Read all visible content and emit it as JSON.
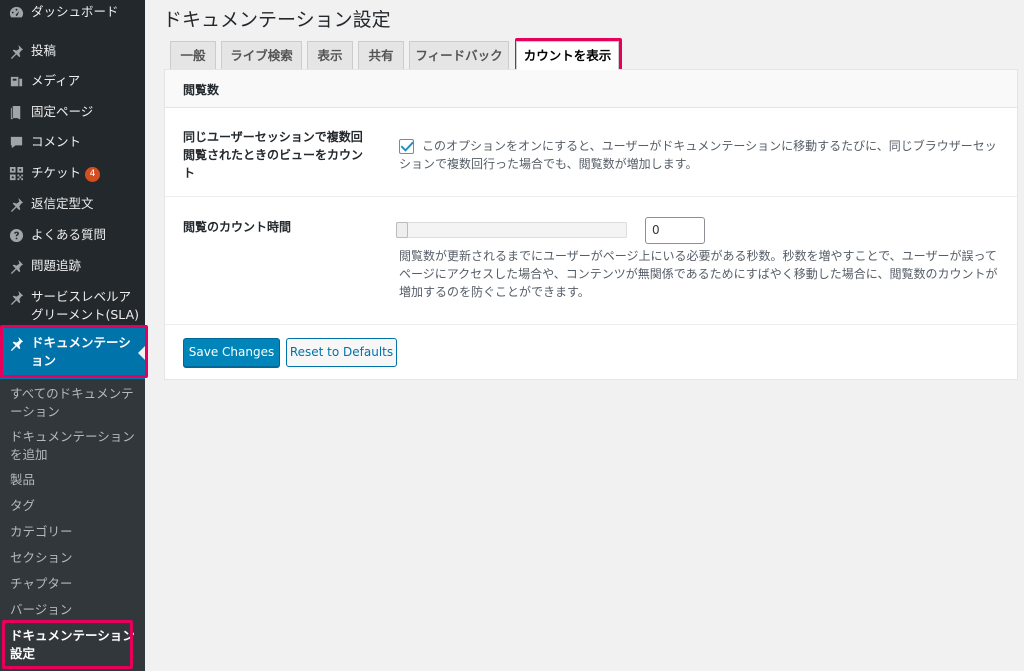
{
  "sidebar": {
    "items": [
      {
        "label": "ダッシュボード",
        "icon": "dashboard-icon"
      },
      {
        "label": "投稿",
        "icon": "pin-icon"
      },
      {
        "label": "メディア",
        "icon": "media-icon"
      },
      {
        "label": "固定ページ",
        "icon": "page-icon"
      },
      {
        "label": "コメント",
        "icon": "comment-icon"
      },
      {
        "label": "チケット",
        "icon": "ticket-icon",
        "badge": "4"
      },
      {
        "label": "返信定型文",
        "icon": "pin-icon"
      },
      {
        "label": "よくある質問",
        "icon": "question-icon"
      },
      {
        "label": "問題追跡",
        "icon": "pin-icon"
      },
      {
        "label": "サービスレベルアグリーメント(SLA)",
        "icon": "pin-icon"
      },
      {
        "label": "ドキュメンテーション",
        "icon": "pin-icon",
        "active": true
      }
    ],
    "submenu": [
      {
        "label": "すべてのドキュメンテーション"
      },
      {
        "label": "ドキュメンテーションを追加"
      },
      {
        "label": "製品"
      },
      {
        "label": "タグ"
      },
      {
        "label": "カテゴリー"
      },
      {
        "label": "セクション"
      },
      {
        "label": "チャプター"
      },
      {
        "label": "バージョン"
      },
      {
        "label": "ドキュメンテーション設定",
        "current": true
      }
    ]
  },
  "page": {
    "title": "ドキュメンテーション設定"
  },
  "tabs": [
    {
      "label": "一般"
    },
    {
      "label": "ライブ検索"
    },
    {
      "label": "表示"
    },
    {
      "label": "共有"
    },
    {
      "label": "フィードバック"
    },
    {
      "label": "カウントを表示",
      "active": true
    }
  ],
  "panel": {
    "heading": "閲覧数",
    "rows": [
      {
        "label": "同じユーザーセッションで複数回閲覧されたときのビューをカウント",
        "checked": true,
        "description": "このオプションをオンにすると、ユーザーがドキュメンテーションに移動するたびに、同じブラウザーセッションで複数回行った場合でも、閲覧数が増加します。"
      },
      {
        "label": "閲覧のカウント時間",
        "value": "0",
        "slider_fraction": 0,
        "description": "閲覧数が更新されるまでにユーザーがページ上にいる必要がある秒数。秒数を増やすことで、ユーザーが誤ってページにアクセスした場合や、コンテンツが無関係であるためにすばやく移動した場合に、閲覧数のカウントが増加するのを防ぐことができます。"
      }
    ]
  },
  "buttons": {
    "save": "Save Changes",
    "reset": "Reset to Defaults"
  },
  "colors": {
    "sidebar_bg": "#23282d",
    "submenu_bg": "#32373c",
    "accent": "#0073aa",
    "primary_button": "#0085ba",
    "highlight": "#e6005c",
    "badge": "#d54e21"
  }
}
